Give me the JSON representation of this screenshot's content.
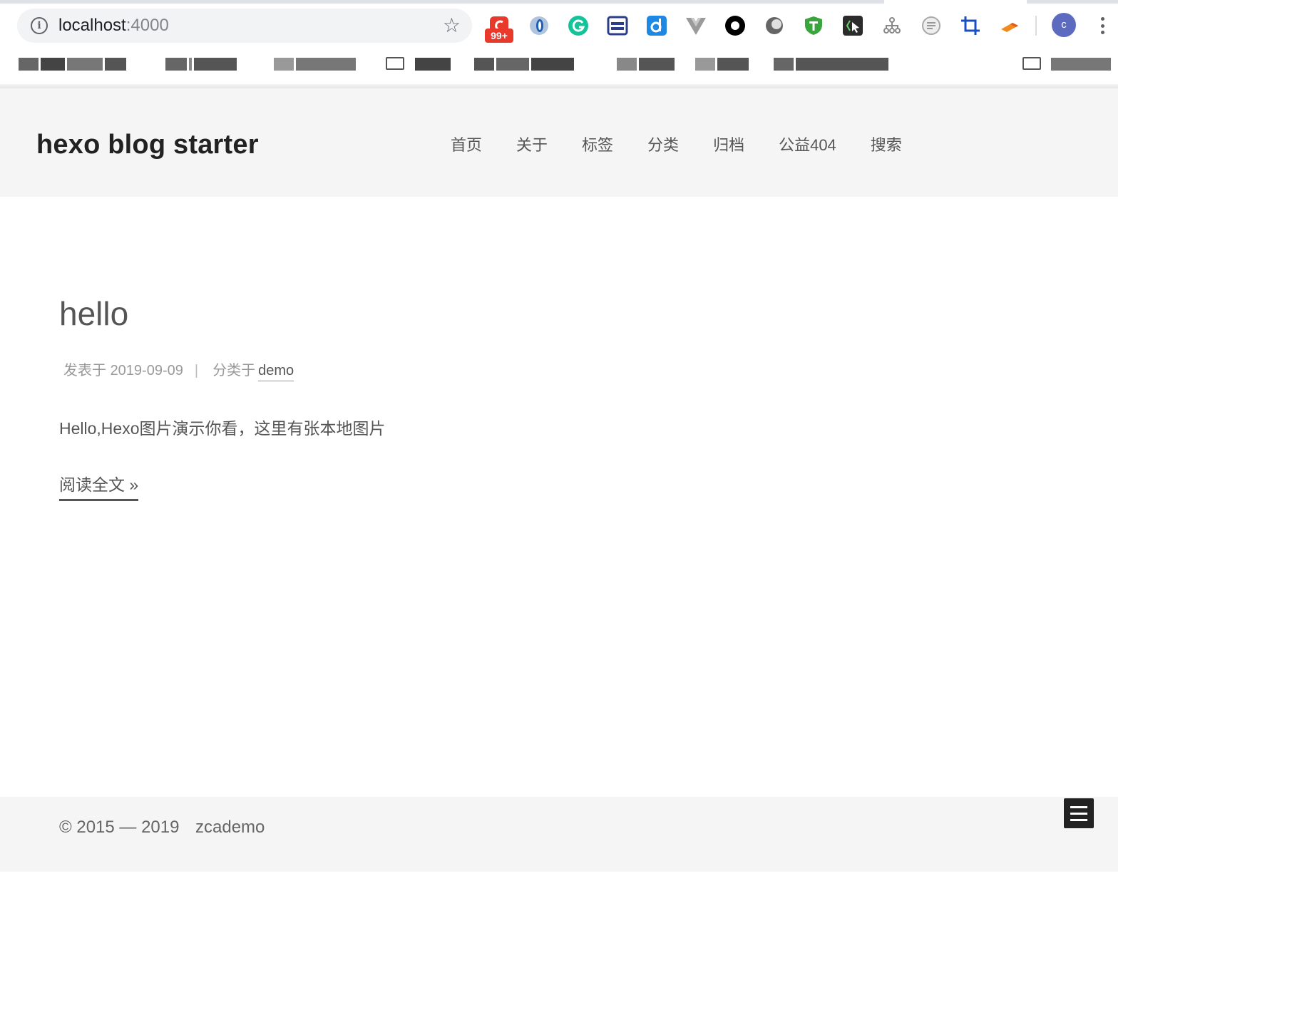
{
  "browser": {
    "url_host": "localhost",
    "url_port": ":4000",
    "extension_badge": "99+",
    "profile_initial": "c",
    "colors": {
      "badge": "#e8392b",
      "avatar": "#5c6bc0"
    },
    "extensions": [
      "cloud-sync-icon",
      "circle-o-icon",
      "grammarly-icon",
      "window-icon",
      "dict-d-icon",
      "vue-devtools-icon",
      "record-icon",
      "moon-icon",
      "shield-t-icon",
      "code-cursor-icon",
      "sitemap-icon",
      "reader-icon",
      "crop-icon",
      "pencil-tool-icon"
    ]
  },
  "site": {
    "title": "hexo blog starter",
    "nav": [
      "首页",
      "关于",
      "标签",
      "分类",
      "归档",
      "公益404",
      "搜索"
    ]
  },
  "post": {
    "title": "hello",
    "meta_posted_prefix": "发表于",
    "date": "2019-09-09",
    "meta_separator": "|",
    "meta_category_prefix": "分类于",
    "category": "demo",
    "excerpt": "Hello,Hexo图片演示你看，这里有张本地图片",
    "read_more": "阅读全文 »"
  },
  "footer": {
    "copyright": "© 2015 — 2019",
    "author": "zcademo"
  }
}
